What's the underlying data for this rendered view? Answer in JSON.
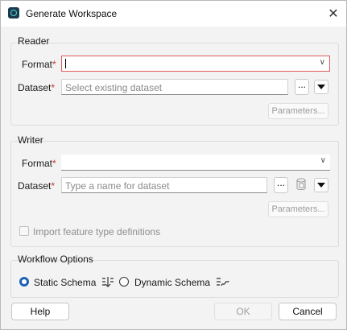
{
  "window": {
    "title": "Generate Workspace",
    "close_glyph": "✕"
  },
  "reader": {
    "group_label": "Reader",
    "format_label": "Format",
    "format_value": "",
    "dataset_label": "Dataset",
    "dataset_placeholder": "Select existing dataset",
    "browse_label": "...",
    "parameters_label": "Parameters..."
  },
  "writer": {
    "group_label": "Writer",
    "format_label": "Format",
    "format_value": "",
    "dataset_label": "Dataset",
    "dataset_placeholder": "Type a name for dataset",
    "browse_label": "...",
    "parameters_label": "Parameters...",
    "import_feature_types_label": "Import feature type definitions",
    "import_feature_types_checked": false
  },
  "required_mark": "*",
  "workflow": {
    "group_label": "Workflow Options",
    "static_schema_label": "Static Schema",
    "dynamic_schema_label": "Dynamic Schema",
    "selected": "static"
  },
  "footer": {
    "help_label": "Help",
    "ok_label": "OK",
    "cancel_label": "Cancel"
  },
  "colors": {
    "focus_border": "#e25b5b",
    "radio_selected": "#1e63b8",
    "required": "#c0392b"
  }
}
